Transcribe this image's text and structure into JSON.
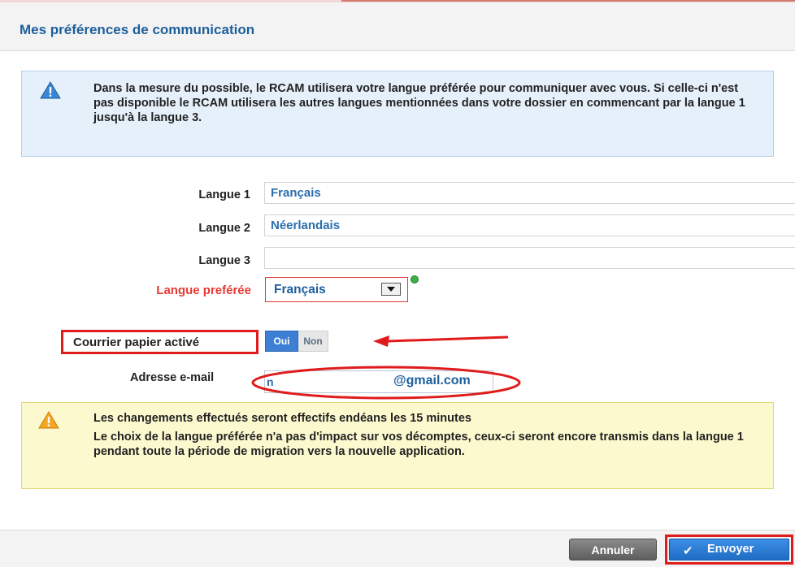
{
  "dialog": {
    "title": "Mes préférences de communication"
  },
  "info": {
    "icon": "info-triangle-icon",
    "text": "Dans la mesure du possible, le RCAM utilisera votre langue préférée pour communiquer avec vous. Si celle-ci n'est pas disponible le RCAM utilisera les autres langues mentionnées dans votre dossier en commencant par la langue 1 jusqu'à la langue 3."
  },
  "fields": {
    "langue1": {
      "label": "Langue 1",
      "value": "Français"
    },
    "langue2": {
      "label": "Langue 2",
      "value": "Néerlandais"
    },
    "langue3": {
      "label": "Langue 3",
      "value": ""
    }
  },
  "preferred": {
    "label": "Langue preférée",
    "selected": "Français"
  },
  "paper_mail": {
    "label": "Courrier papier activé",
    "on_label": "Oui",
    "off_label": "Non",
    "active": "Oui"
  },
  "email": {
    "label": "Adresse e-mail",
    "prefix": "n",
    "domain": "@gmail.com"
  },
  "warning": {
    "icon": "warning-triangle-icon",
    "title": "Les changements effectués seront effectifs endéans les 15 minutes",
    "text": "Le choix de la langue préférée n'a pas d'impact sur vos décomptes, ceux-ci seront encore transmis dans la langue 1 pendant toute la période de migration vers la nouvelle application."
  },
  "footer": {
    "cancel_label": "Annuler",
    "send_label": "Envoyer"
  },
  "colors": {
    "accent": "#1d5f9c",
    "annotation_red": "#e01b1b",
    "button_blue": "#2a7bd6"
  }
}
